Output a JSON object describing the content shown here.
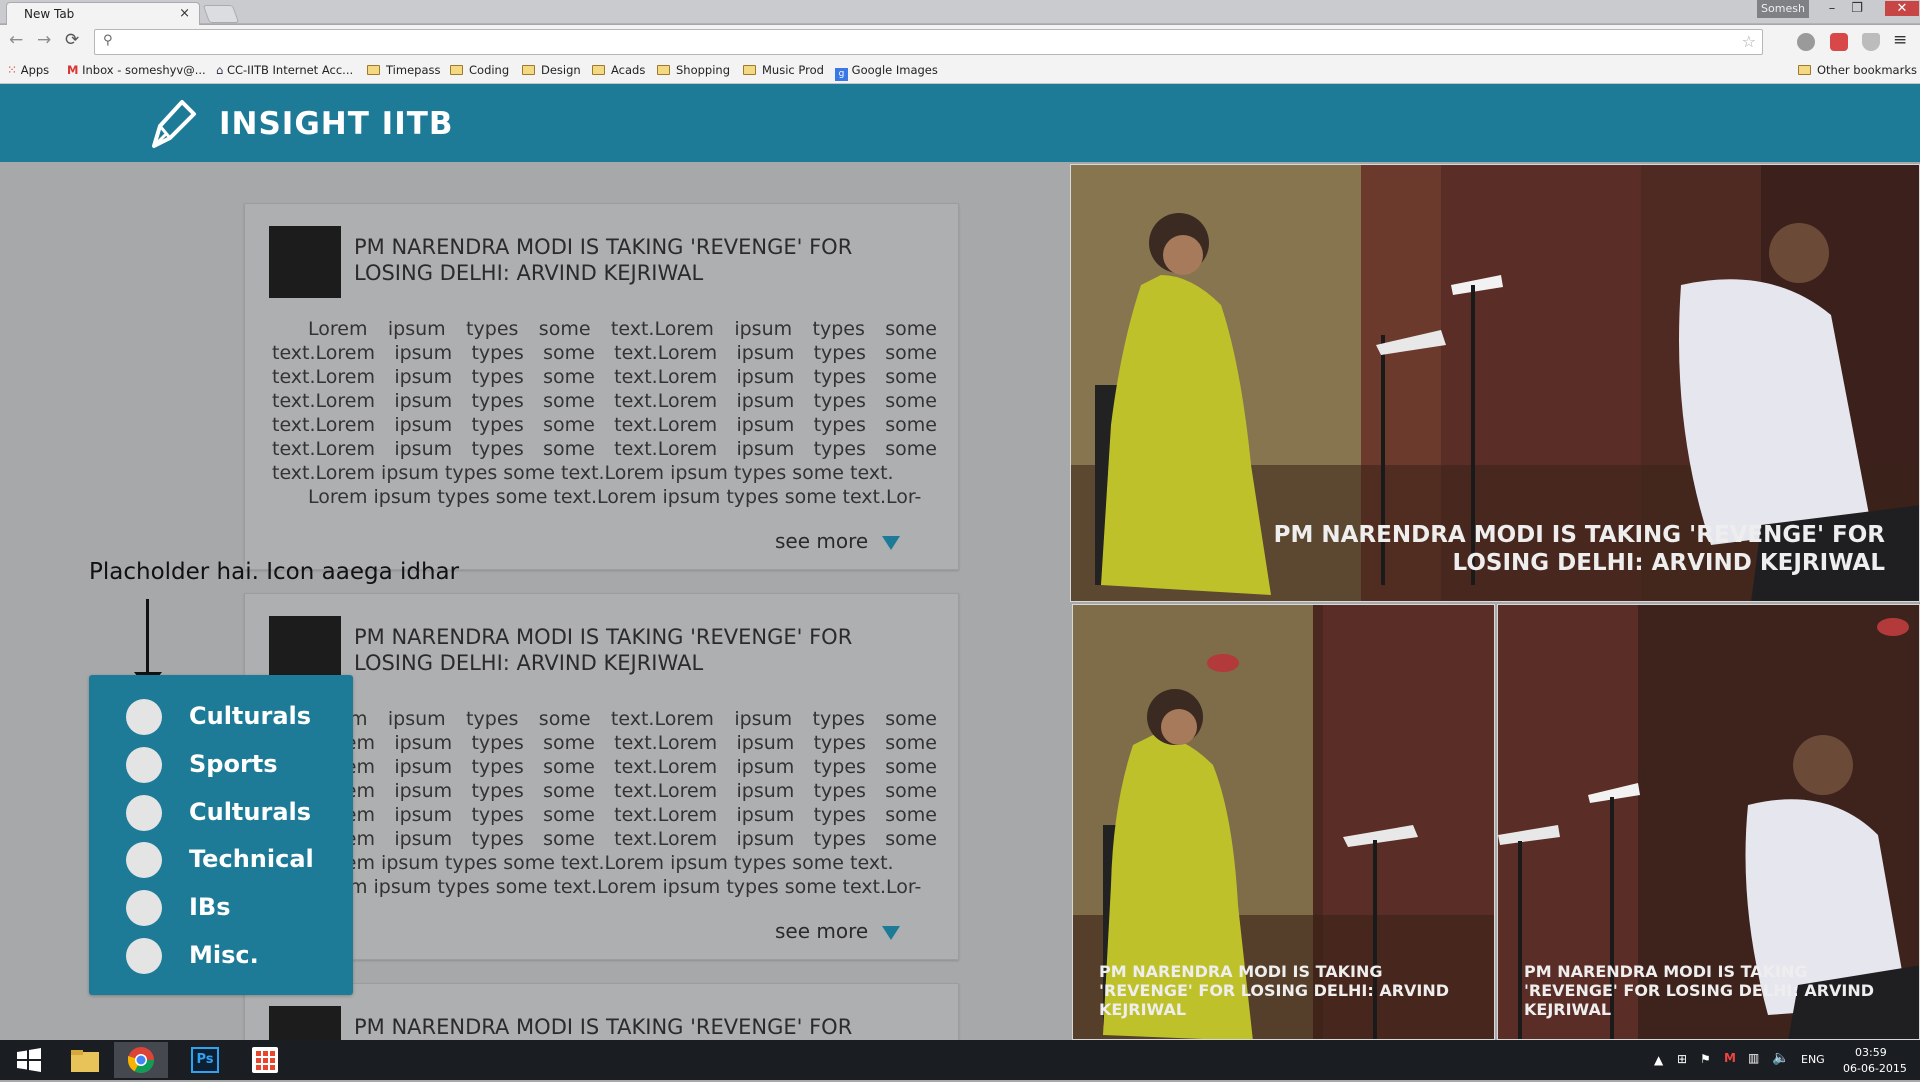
{
  "browser": {
    "tab_title": "New Tab",
    "tab_close": "×",
    "profile_name": "Somesh",
    "window_controls": [
      "–",
      "❐",
      "✕"
    ]
  },
  "bookmarks": [
    {
      "label": "Apps",
      "icon": "apps-grid-icon"
    },
    {
      "label": "Inbox - someshyv@...",
      "icon": "gmail-icon"
    },
    {
      "label": "CC-IITB Internet Acc...",
      "icon": "network-icon"
    },
    {
      "label": "Timepass",
      "icon": "folder-icon"
    },
    {
      "label": "Coding",
      "icon": "folder-icon"
    },
    {
      "label": "Design",
      "icon": "folder-icon"
    },
    {
      "label": "Acads",
      "icon": "folder-icon"
    },
    {
      "label": "Shopping",
      "icon": "folder-icon"
    },
    {
      "label": "Music Prod",
      "icon": "folder-icon"
    },
    {
      "label": "Google Images",
      "icon": "google-icon"
    }
  ],
  "other_bookmarks": "Other bookmarks",
  "site": {
    "title": "INSIGHT IITB",
    "brand_color": "#1d7b97"
  },
  "articles": [
    {
      "title": "PM NARENDRA MODI IS TAKING 'REVENGE' FOR LOSING DELHI: ARVIND KEJRIWAL",
      "body1": "Lorem ipsum types some text.Lorem ipsum types some text.Lorem ipsum types some text.Lorem ipsum types some text.Lorem ipsum types some text.Lorem ipsum types some text.Lorem ipsum types some text.Lorem ipsum types some text.Lorem ipsum types some text.Lorem ipsum types some text.Lorem ipsum types some text.Lorem ipsum types some text.Lorem ipsum types some text.Lorem ipsum types some text.",
      "body2": "Lorem ipsum types some text.Lorem ipsum types some text.Lor-",
      "see_more": "see more"
    },
    {
      "title": "PM NARENDRA MODI IS TAKING 'REVENGE' FOR LOSING DELHI: ARVIND KEJRIWAL",
      "body1": "Lorem ipsum types some text.Lorem ipsum types some text.Lorem ipsum types some text.Lorem ipsum types some text.Lorem ipsum types some text.Lorem ipsum types some text.Lorem ipsum types some text.Lorem ipsum types some text.Lorem ipsum types some text.Lorem ipsum types some text.Lorem ipsum types some text.Lorem ipsum types some text.Lorem ipsum types some text.Lorem ipsum types some text.",
      "body2": "Lorem ipsum types some text.Lorem ipsum types some text.Lor-",
      "see_more": "see more"
    },
    {
      "title": "PM NARENDRA MODI IS TAKING 'REVENGE' FOR"
    }
  ],
  "annotation": "Placholder hai. Icon aaega idhar",
  "categories": [
    "Culturals",
    "Sports",
    "Culturals",
    "Technical",
    "IBs",
    "Misc."
  ],
  "featured": {
    "main_caption": "PM NARENDRA MODI IS TAKING 'REVENGE' FOR LOSING DELHI: ARVIND KEJRIWAL",
    "left_caption": "PM NARENDRA MODI IS TAKING 'REVENGE' FOR LOSING DELHI: ARVIND KEJRIWAL",
    "right_caption": "PM NARENDRA MODI IS TAKING 'REVENGE' FOR LOSING DELHI: ARVIND KEJRIWAL"
  },
  "taskbar": {
    "apps": [
      "start-icon",
      "file-explorer-icon",
      "chrome-icon",
      "photoshop-icon",
      "apps-icon"
    ],
    "photoshop_label": "Ps",
    "language": "ENG",
    "time": "03:59",
    "date": "06-06-2015"
  }
}
